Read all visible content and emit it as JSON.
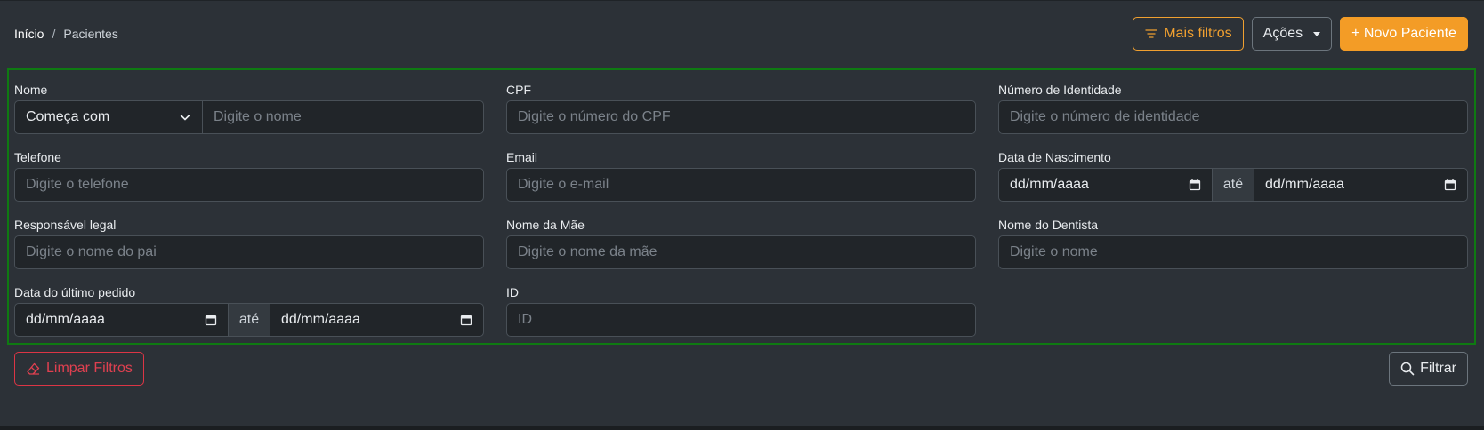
{
  "breadcrumb": {
    "home": "Início",
    "separator": "/",
    "current": "Pacientes"
  },
  "toolbar": {
    "more_filters": "Mais filtros",
    "actions": "Ações",
    "new_patient": "+ Novo Paciente"
  },
  "filters": {
    "nome": {
      "label": "Nome",
      "match_mode": "Começa com",
      "placeholder": "Digite o nome",
      "value": ""
    },
    "cpf": {
      "label": "CPF",
      "placeholder": "Digite o número do CPF",
      "value": ""
    },
    "identidade": {
      "label": "Número de Identidade",
      "placeholder": "Digite o número de identidade",
      "value": ""
    },
    "telefone": {
      "label": "Telefone",
      "placeholder": "Digite o telefone",
      "value": ""
    },
    "email": {
      "label": "Email",
      "placeholder": "Digite o e-mail",
      "value": ""
    },
    "nascimento": {
      "label": "Data de Nascimento",
      "from": "dd/mm/aaaa",
      "to_label": "até",
      "to": "dd/mm/aaaa"
    },
    "responsavel": {
      "label": "Responsável legal",
      "placeholder": "Digite o nome do pai",
      "value": ""
    },
    "mae": {
      "label": "Nome da Mãe",
      "placeholder": "Digite o nome da mãe",
      "value": ""
    },
    "dentista": {
      "label": "Nome do Dentista",
      "placeholder": "Digite o nome",
      "value": ""
    },
    "ultimo_pedido": {
      "label": "Data do último pedido",
      "from": "dd/mm/aaaa",
      "to_label": "até",
      "to": "dd/mm/aaaa"
    },
    "id": {
      "label": "ID",
      "placeholder": "ID",
      "value": ""
    }
  },
  "footer": {
    "clear": "Limpar Filtros",
    "filter": "Filtrar"
  },
  "colors": {
    "warning": "#f39c26",
    "danger": "#dc3545",
    "panel_border": "#0f7a12",
    "background": "#2c3137"
  }
}
